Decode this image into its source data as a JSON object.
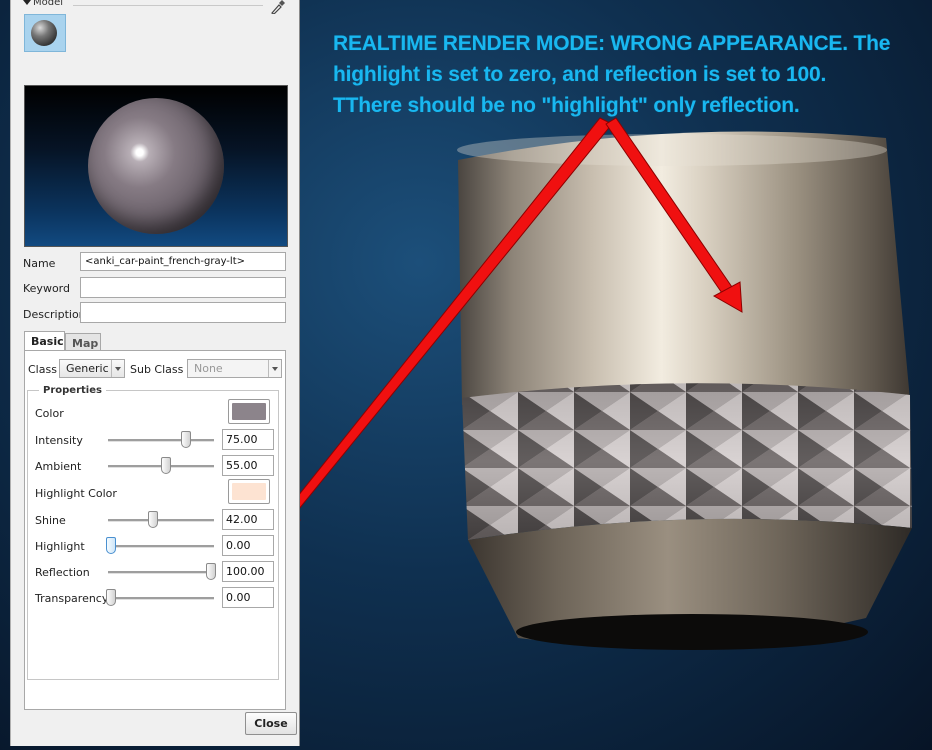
{
  "panel": {
    "section_title": "Model",
    "name_label": "Name",
    "name_value": "<anki_car-paint_french-gray-lt>",
    "keyword_label": "Keyword",
    "keyword_value": "",
    "description_label": "Description",
    "description_value": "",
    "tabs": [
      {
        "label": "Basic",
        "active": true
      },
      {
        "label": "Map",
        "active": false
      }
    ],
    "class_label": "Class",
    "class_value": "Generic",
    "subclass_label": "Sub Class",
    "subclass_value": "None",
    "properties_title": "Properties",
    "color_label": "Color",
    "color_value": "#8c848b",
    "highlight_color_label": "Highlight Color",
    "highlight_color_value": "#fde3d2",
    "sliders": [
      {
        "label": "Intensity",
        "value": "75.00",
        "fraction": 0.75
      },
      {
        "label": "Ambient",
        "value": "55.00",
        "fraction": 0.55
      },
      {
        "label": "Shine",
        "value": "42.00",
        "fraction": 0.42
      },
      {
        "label": "Highlight",
        "value": "0.00",
        "fraction": 0.0
      },
      {
        "label": "Reflection",
        "value": "100.00",
        "fraction": 1.0
      },
      {
        "label": "Transparency",
        "value": "0.00",
        "fraction": 0.0
      }
    ],
    "close_label": "Close"
  },
  "annotation": {
    "lines": [
      "REALTIME RENDER MODE: WRONG APPEARANCE.  The",
      "highlight is set to zero, and reflection is set to 100.",
      "TThere should be no \"highlight\" only reflection."
    ],
    "color": "#19b7f0"
  },
  "icons": {
    "collapse": "triangle-down-icon",
    "eyedropper": "eyedropper-icon"
  },
  "colors": {
    "arrow": "#f01010",
    "viewport": "#0f3050"
  }
}
